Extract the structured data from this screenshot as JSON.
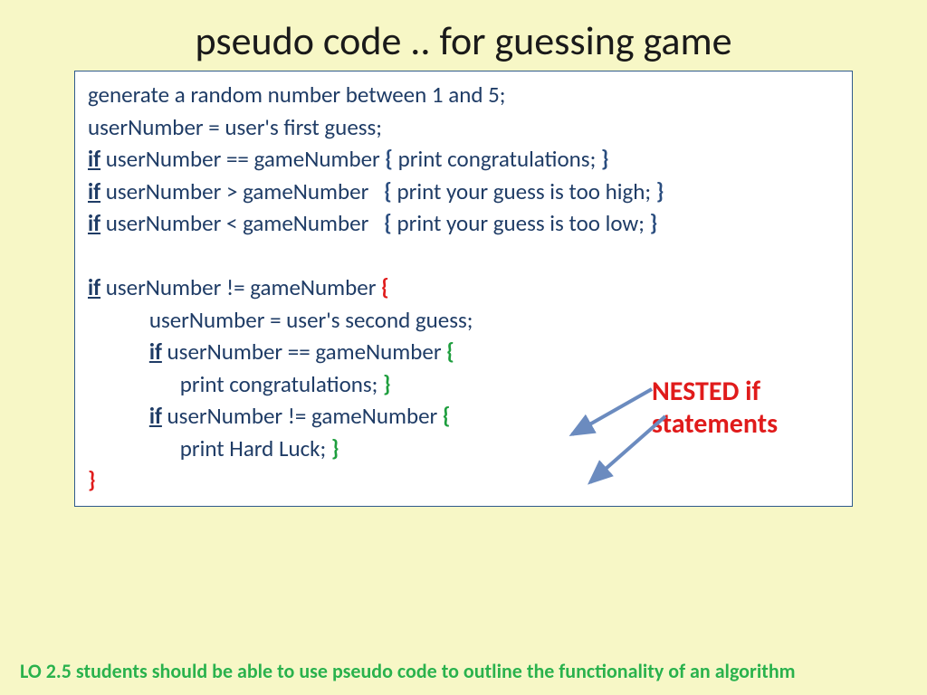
{
  "title": "pseudo code .. for guessing game",
  "code": {
    "l1": "generate a random number between 1 and 5;",
    "l2": "userNumber = user's first guess;",
    "l3a": " userNumber == gameNumber ",
    "l3b": " print congratulations; ",
    "l4a": " userNumber > gameNumber   ",
    "l4b": " print your guess is too high; ",
    "l5a": " userNumber < gameNumber   ",
    "l5b": " print your guess is too low; ",
    "l7a": " userNumber != gameNumber ",
    "l8": "            userNumber = user's second guess;",
    "l9a": " userNumber == gameNumber ",
    "l10": "                  print congratulations; ",
    "l11a": " userNumber != gameNumber ",
    "l12": "                  print Hard Luck; ",
    "kw_if": "if",
    "brace_open": "{",
    "brace_close": "}"
  },
  "callout": {
    "line1": "NESTED if",
    "line2": "statements"
  },
  "footer": "LO 2.5 students should be able to use pseudo code to outline the functionality of an algorithm"
}
